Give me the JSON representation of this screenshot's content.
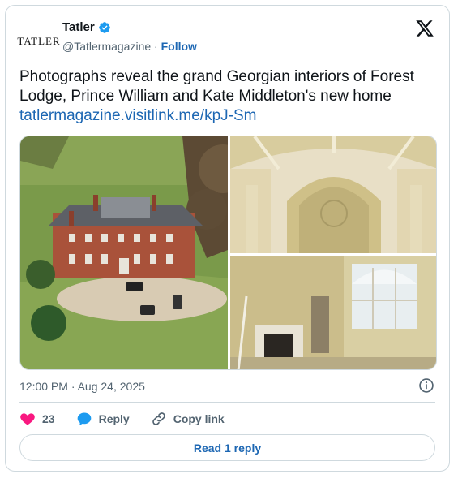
{
  "author": {
    "logo_text": "TATLER",
    "name": "Tatler",
    "handle": "@Tatlermagazine",
    "separator": "·",
    "follow_label": "Follow",
    "verified_icon": "verified-badge-icon",
    "verified_color": "#1d9bf0"
  },
  "tweet": {
    "text": "Photographs reveal the grand Georgian interiors of Forest Lodge, Prince William and Kate Middleton's new home",
    "link": "tatlermagazine.visitlink.me/kpJ-Sm",
    "timestamp": "12:00 PM · Aug 24, 2025"
  },
  "media": {
    "images": [
      "aerial-house-photo",
      "arched-ceiling-interior-photo",
      "fireplace-window-interior-photo"
    ]
  },
  "actions": {
    "like_count": "23",
    "like_color": "#f91880",
    "reply_label": "Reply",
    "copy_label": "Copy link"
  },
  "read_replies_label": "Read 1 reply",
  "colors": {
    "link": "#1d67b3",
    "border": "#cfd9de",
    "muted": "#536471"
  }
}
